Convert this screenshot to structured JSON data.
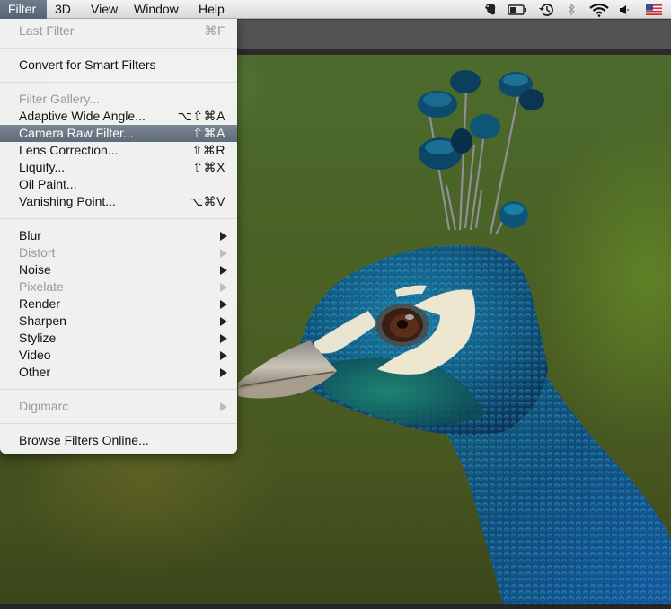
{
  "menubar": {
    "menus": [
      {
        "label": "Filter",
        "active": true
      },
      {
        "label": "3D",
        "active": false
      },
      {
        "label": "View",
        "active": false
      },
      {
        "label": "Window",
        "active": false
      },
      {
        "label": "Help",
        "active": false
      }
    ],
    "status_icons": [
      "evernote-elephant-icon",
      "battery-icon",
      "time-machine-icon",
      "bluetooth-icon",
      "wifi-icon",
      "volume-icon",
      "us-flag-input-icon"
    ]
  },
  "filter_menu": {
    "items": [
      {
        "label": "Last Filter",
        "shortcut": "⌘F",
        "enabled": false
      },
      {
        "label": "Convert for Smart Filters",
        "shortcut": "",
        "enabled": true
      },
      {
        "label": "Filter Gallery...",
        "shortcut": "",
        "enabled": false
      },
      {
        "label": "Adaptive Wide Angle...",
        "shortcut": "⌥⇧⌘A",
        "enabled": true
      },
      {
        "label": "Camera Raw Filter...",
        "shortcut": "⇧⌘A",
        "enabled": true,
        "highlighted": true
      },
      {
        "label": "Lens Correction...",
        "shortcut": "⇧⌘R",
        "enabled": true
      },
      {
        "label": "Liquify...",
        "shortcut": "⇧⌘X",
        "enabled": true
      },
      {
        "label": "Oil Paint...",
        "shortcut": "",
        "enabled": true
      },
      {
        "label": "Vanishing Point...",
        "shortcut": "⌥⌘V",
        "enabled": true
      },
      {
        "label": "Blur",
        "submenu": true,
        "enabled": true
      },
      {
        "label": "Distort",
        "submenu": true,
        "enabled": false
      },
      {
        "label": "Noise",
        "submenu": true,
        "enabled": true
      },
      {
        "label": "Pixelate",
        "submenu": true,
        "enabled": false
      },
      {
        "label": "Render",
        "submenu": true,
        "enabled": true
      },
      {
        "label": "Sharpen",
        "submenu": true,
        "enabled": true
      },
      {
        "label": "Stylize",
        "submenu": true,
        "enabled": true
      },
      {
        "label": "Video",
        "submenu": true,
        "enabled": true
      },
      {
        "label": "Other",
        "submenu": true,
        "enabled": true
      },
      {
        "label": "Digimarc",
        "submenu": true,
        "enabled": false
      },
      {
        "label": "Browse Filters Online...",
        "shortcut": "",
        "enabled": true
      }
    ]
  },
  "canvas": {
    "image_subject": "peacock head in profile against blurred green background"
  },
  "colors": {
    "menu_highlight": "#66727f",
    "options_bar": "#535353",
    "disabled_text": "#9a9a9a"
  }
}
